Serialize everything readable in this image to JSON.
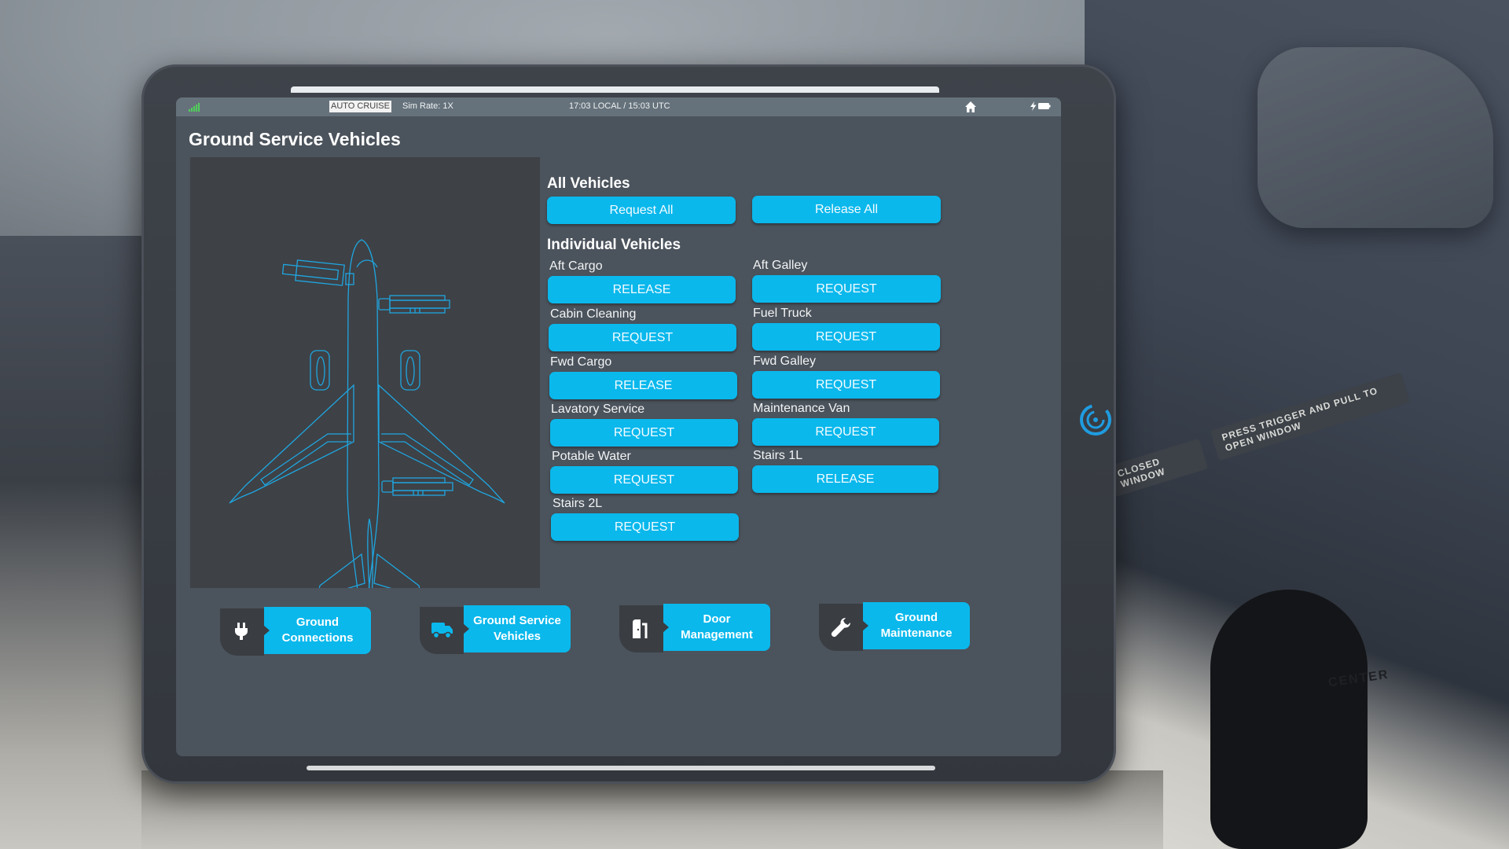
{
  "status_bar": {
    "signal_icon": "signal-bars-icon",
    "mode": "AUTO CRUISE",
    "sim_rate": "Sim Rate: 1X",
    "clock": "17:03 LOCAL / 15:03 UTC",
    "home_icon": "home-icon",
    "power_icon": "charging-battery-icon"
  },
  "page": {
    "title": "Ground Service Vehicles"
  },
  "all_vehicles": {
    "heading": "All Vehicles",
    "request_all": "Request All",
    "release_all": "Release All"
  },
  "individual_vehicles": {
    "heading": "Individual Vehicles",
    "left_column": [
      {
        "name": "Aft Cargo",
        "action": "RELEASE"
      },
      {
        "name": "Cabin Cleaning",
        "action": "REQUEST"
      },
      {
        "name": "Fwd Cargo",
        "action": "RELEASE"
      },
      {
        "name": "Lavatory Service",
        "action": "REQUEST"
      },
      {
        "name": "Potable Water",
        "action": "REQUEST"
      },
      {
        "name": "Stairs 2L",
        "action": "REQUEST"
      }
    ],
    "right_column": [
      {
        "name": "Aft Galley",
        "action": "REQUEST"
      },
      {
        "name": "Fuel Truck",
        "action": "REQUEST"
      },
      {
        "name": "Fwd Galley",
        "action": "REQUEST"
      },
      {
        "name": "Maintenance Van",
        "action": "REQUEST"
      },
      {
        "name": "Stairs 1L",
        "action": "RELEASE"
      }
    ]
  },
  "nav": [
    {
      "icon": "plug-icon",
      "label_line1": "Ground",
      "label_line2": "Connections"
    },
    {
      "icon": "truck-icon",
      "label_line1": "Ground Service",
      "label_line2": "Vehicles"
    },
    {
      "icon": "door-icon",
      "label_line1": "Door",
      "label_line2": "Management"
    },
    {
      "icon": "wrench-icon",
      "label_line1": "Ground",
      "label_line2": "Maintenance"
    }
  ],
  "background_placards": {
    "window_instruction": "PRESS TRIGGER AND PULL TO OPEN WINDOW",
    "closed_window": "CLOSED WINDOW",
    "center": "CENTER"
  },
  "colors": {
    "accent": "#0ab8ec",
    "screen_bg": "#4b535c",
    "diagram_bg": "#3e4146",
    "diagram_line": "#1fa6e0",
    "status_bar": "#66727b"
  }
}
